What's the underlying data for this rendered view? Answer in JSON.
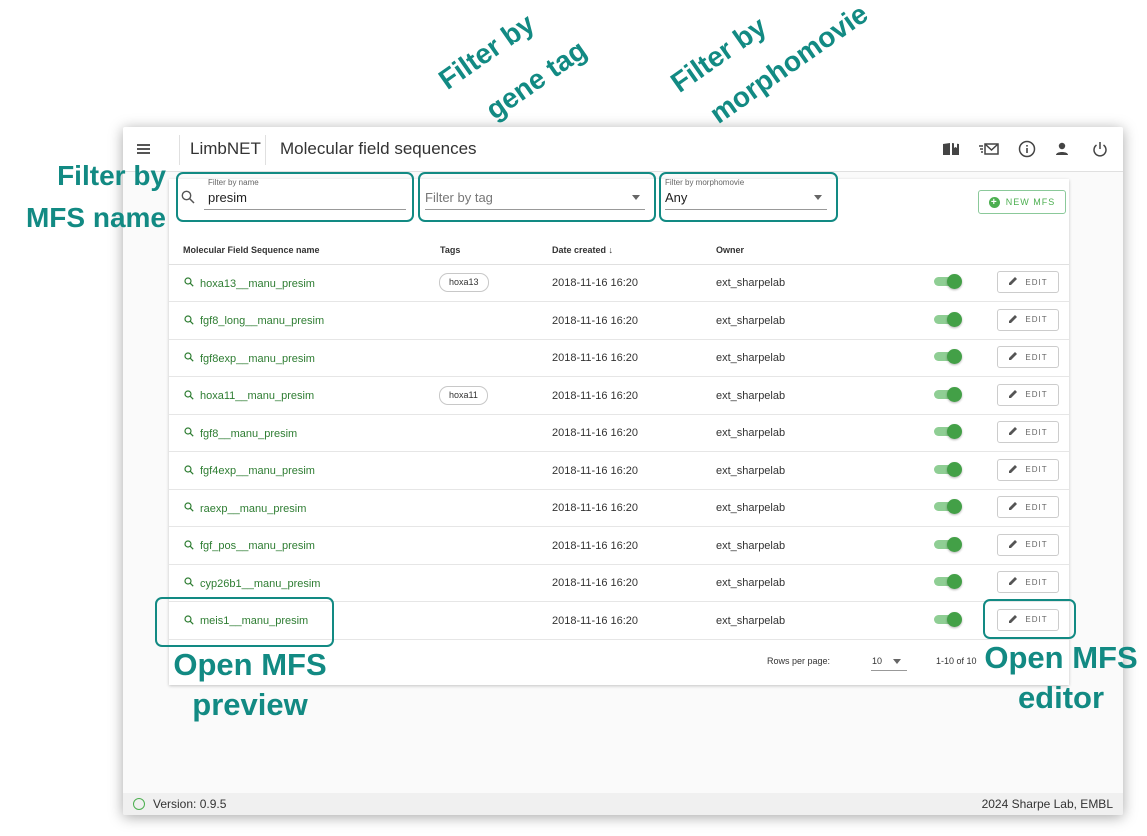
{
  "app": {
    "brand": "LimbNET",
    "page_title": "Molecular field sequences",
    "toolbar_icons": [
      "book-icon",
      "mail-icon",
      "info-icon",
      "person-icon",
      "power-icon"
    ]
  },
  "filters": {
    "name_label": "Filter by name",
    "name_value": "presim",
    "tag_placeholder": "Filter by tag",
    "morpho_label": "Filter by morphomovie",
    "morpho_value": "Any"
  },
  "new_button_label": "NEW MFS",
  "table": {
    "headers": {
      "name": "Molecular Field Sequence name",
      "tags": "Tags",
      "date": "Date created",
      "owner": "Owner"
    },
    "edit_label": "EDIT",
    "rows": [
      {
        "name": "hoxa13__manu_presim",
        "tag": "hoxa13",
        "date": "2018-11-16 16:20",
        "owner": "ext_sharpelab"
      },
      {
        "name": "fgf8_long__manu_presim",
        "tag": "",
        "date": "2018-11-16 16:20",
        "owner": "ext_sharpelab"
      },
      {
        "name": "fgf8exp__manu_presim",
        "tag": "",
        "date": "2018-11-16 16:20",
        "owner": "ext_sharpelab"
      },
      {
        "name": "hoxa11__manu_presim",
        "tag": "hoxa11",
        "date": "2018-11-16 16:20",
        "owner": "ext_sharpelab"
      },
      {
        "name": "fgf8__manu_presim",
        "tag": "",
        "date": "2018-11-16 16:20",
        "owner": "ext_sharpelab"
      },
      {
        "name": "fgf4exp__manu_presim",
        "tag": "",
        "date": "2018-11-16 16:20",
        "owner": "ext_sharpelab"
      },
      {
        "name": "raexp__manu_presim",
        "tag": "",
        "date": "2018-11-16 16:20",
        "owner": "ext_sharpelab"
      },
      {
        "name": "fgf_pos__manu_presim",
        "tag": "",
        "date": "2018-11-16 16:20",
        "owner": "ext_sharpelab"
      },
      {
        "name": "cyp26b1__manu_presim",
        "tag": "",
        "date": "2018-11-16 16:20",
        "owner": "ext_sharpelab"
      },
      {
        "name": "meis1__manu_presim",
        "tag": "",
        "date": "2018-11-16 16:20",
        "owner": "ext_sharpelab"
      }
    ]
  },
  "pagination": {
    "rows_label": "Rows per page:",
    "rows_value": "10",
    "range": "1-10 of 10"
  },
  "status": {
    "version": "Version: 0.9.5",
    "copyright": "2024 Sharpe Lab, EMBL"
  },
  "annotations": {
    "filter_name_l1": "Filter by",
    "filter_name_l2": "MFS name",
    "filter_tag_l1": "Filter by",
    "filter_tag_l2": "gene tag",
    "filter_morpho_l1": "Filter by",
    "filter_morpho_l2": "morphomovie",
    "open_preview_l1": "Open MFS",
    "open_preview_l2": "preview",
    "open_editor_l1": "Open MFS",
    "open_editor_l2": "editor"
  },
  "colors": {
    "annotation": "#128a83",
    "accent_green": "#43a047",
    "link_green": "#2e7d32"
  }
}
